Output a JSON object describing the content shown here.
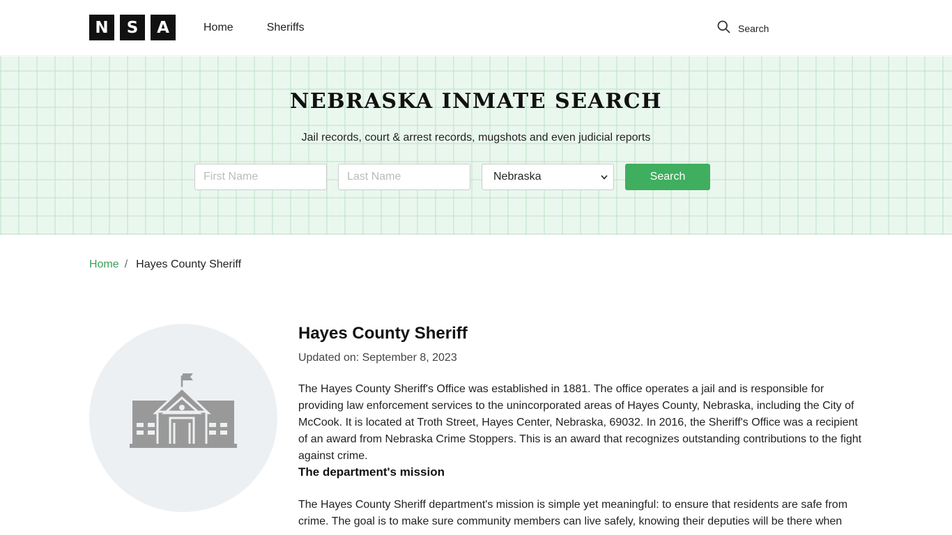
{
  "header": {
    "logo_letters": [
      "N",
      "S",
      "A"
    ],
    "nav": [
      {
        "label": "Home"
      },
      {
        "label": "Sheriffs"
      }
    ],
    "search_label": "Search"
  },
  "hero": {
    "title": "NEBRASKA INMATE SEARCH",
    "subtitle": "Jail records, court & arrest records, mugshots and even judicial reports",
    "first_name_placeholder": "First Name",
    "last_name_placeholder": "Last Name",
    "state_selected": "Nebraska",
    "search_button": "Search"
  },
  "breadcrumb": {
    "home": "Home",
    "separator": "/",
    "current": "Hayes County Sheriff"
  },
  "article": {
    "title": "Hayes County Sheriff",
    "updated": "Updated on: September 8, 2023",
    "paragraph1": "The Hayes County Sheriff's Office was established in 1881. The office operates a jail and is responsible for providing law enforcement services to the unincorporated areas of Hayes County, Nebraska, including the City of McCook. It is located at Troth Street, Hayes Center, Nebraska, 69032. In 2016, the Sheriff's Office was a recipient of an award from Nebraska Crime Stoppers. This is an award that recognizes outstanding contributions to the fight against crime.",
    "mission_heading": "The department's mission",
    "paragraph2": "The Hayes County Sheriff department's mission is simple yet meaningful: to ensure that residents are safe from crime. The goal is to make sure community members can live safely, knowing their deputies will be there when"
  },
  "icons": {
    "header_search": "search-icon",
    "building": "government-building-icon",
    "select_caret": "chevron-down-icon"
  },
  "colors": {
    "accent_green": "#3fae5e",
    "link_green": "#3a9e5a",
    "hero_bg": "#eaf7ee"
  }
}
